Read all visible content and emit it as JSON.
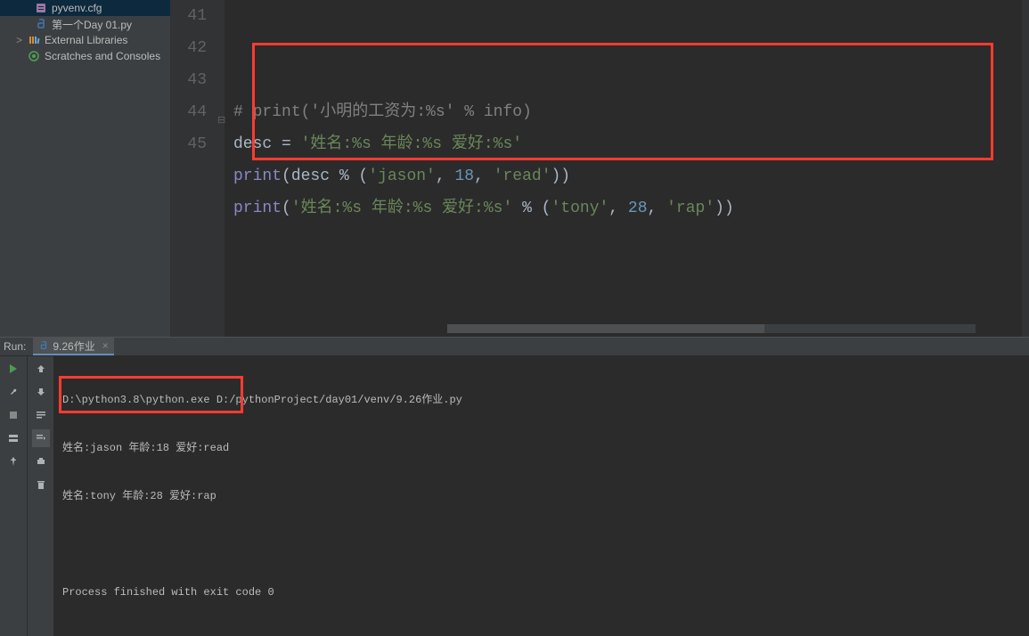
{
  "sidebar": {
    "items": [
      {
        "label": "pyvenv.cfg",
        "icon": "cfg"
      },
      {
        "label": "第一个Day 01.py",
        "icon": "py"
      },
      {
        "label": "External Libraries",
        "icon": "lib",
        "arrow": ">"
      },
      {
        "label": "Scratches and Consoles",
        "icon": "scratch"
      }
    ]
  },
  "editor": {
    "lines": [
      {
        "no": "41",
        "tokens": [
          {
            "cls": "tok-comment",
            "t": "# "
          },
          {
            "cls": "tok-comment",
            "t": "print"
          },
          {
            "cls": "tok-comment",
            "t": "('小明的工资为:%s' % info)"
          }
        ],
        "fold": true
      },
      {
        "no": "42",
        "tokens": [
          {
            "cls": "tok-ident",
            "t": "desc "
          },
          {
            "cls": "tok-op",
            "t": "= "
          },
          {
            "cls": "tok-string",
            "t": "'姓名:%s 年龄:%s 爱好:%s'"
          }
        ]
      },
      {
        "no": "43",
        "tokens": [
          {
            "cls": "tok-builtin",
            "t": "print"
          },
          {
            "cls": "tok-op",
            "t": "(desc "
          },
          {
            "cls": "tok-op",
            "t": "% ("
          },
          {
            "cls": "tok-string",
            "t": "'jason'"
          },
          {
            "cls": "tok-op",
            "t": ", "
          },
          {
            "cls": "tok-number",
            "t": "18"
          },
          {
            "cls": "tok-op",
            "t": ", "
          },
          {
            "cls": "tok-string",
            "t": "'read'"
          },
          {
            "cls": "tok-op",
            "t": "))"
          }
        ]
      },
      {
        "no": "44",
        "tokens": [
          {
            "cls": "tok-builtin",
            "t": "print"
          },
          {
            "cls": "tok-op",
            "t": "("
          },
          {
            "cls": "tok-string",
            "t": "'姓名:%s 年龄:%s 爱好:%s'"
          },
          {
            "cls": "tok-op",
            "t": " % ("
          },
          {
            "cls": "tok-string",
            "t": "'tony'"
          },
          {
            "cls": "tok-op",
            "t": ", "
          },
          {
            "cls": "tok-number",
            "t": "28"
          },
          {
            "cls": "tok-op",
            "t": ", "
          },
          {
            "cls": "tok-string",
            "t": "'rap'"
          },
          {
            "cls": "tok-op",
            "t": "))"
          }
        ]
      },
      {
        "no": "45",
        "tokens": []
      }
    ]
  },
  "run": {
    "header_label": "Run:",
    "tab_label": "9.26作业",
    "tab_close": "×",
    "cmd": "D:\\python3.8\\python.exe D:/pythonProject/day01/venv/9.26作业.py",
    "out1": "姓名:jason 年龄:18 爱好:read",
    "out2": "姓名:tony 年龄:28 爱好:rap",
    "exit": "Process finished with exit code 0"
  }
}
